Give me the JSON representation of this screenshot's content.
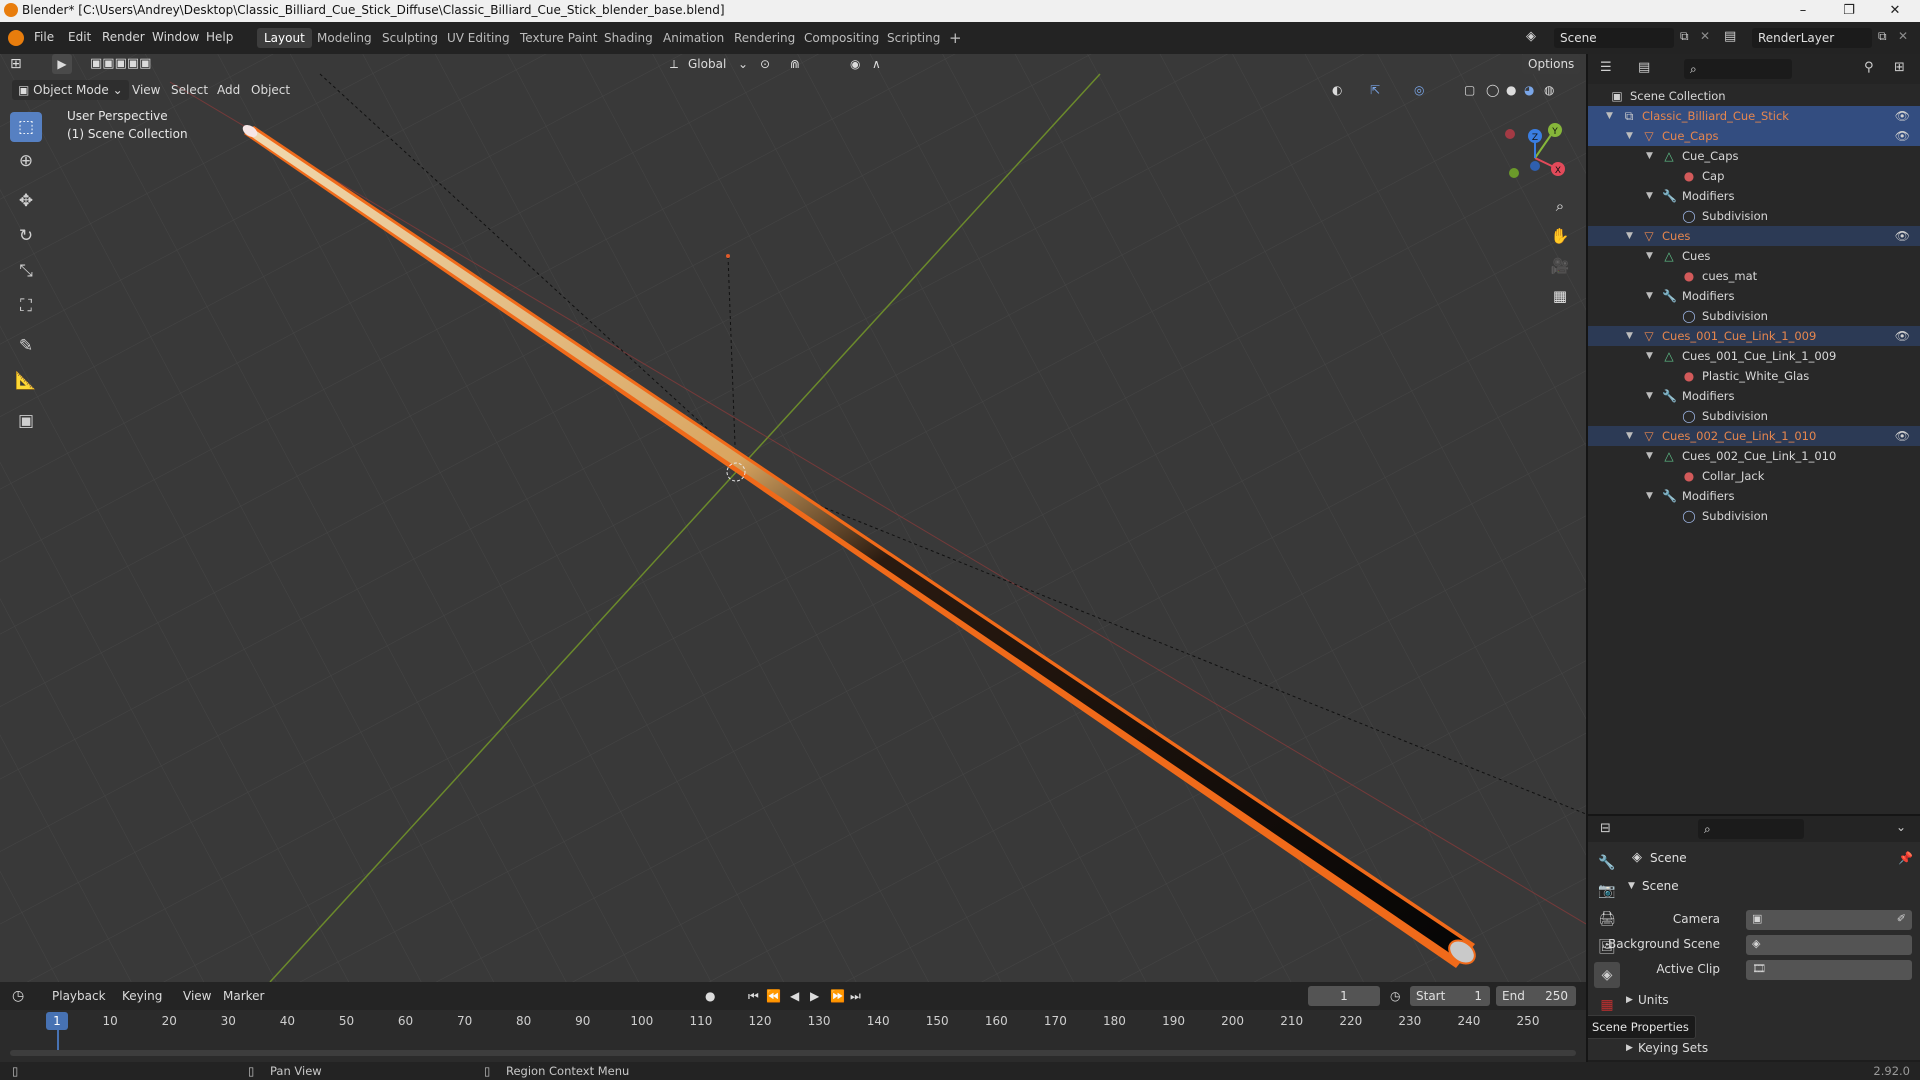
{
  "window": {
    "title": "Blender* [C:\\Users\\Andrey\\Desktop\\Classic_Billiard_Cue_Stick_Diffuse\\Classic_Billiard_Cue_Stick_blender_base.blend]",
    "minimize": "–",
    "maximize": "❐",
    "close": "✕"
  },
  "menu": [
    "File",
    "Edit",
    "Render",
    "Window",
    "Help"
  ],
  "workspaces": [
    "Layout",
    "Modeling",
    "Sculpting",
    "UV Editing",
    "Texture Paint",
    "Shading",
    "Animation",
    "Rendering",
    "Compositing",
    "Scripting"
  ],
  "add_workspace": "+",
  "scene_name": "Scene",
  "render_layer": "RenderLayer",
  "toolbar": {
    "transform_orientation": "Global",
    "options": "Options"
  },
  "viewport": {
    "mode": "Object Mode",
    "menus": [
      "View",
      "Select",
      "Add",
      "Object"
    ],
    "perspective": "User Perspective",
    "collection": "(1) Scene Collection",
    "gizmo": {
      "x": "X",
      "y": "Y",
      "z": "Z"
    }
  },
  "outliner": {
    "root": "Scene Collection",
    "rows": [
      {
        "label": "Classic_Billiard_Cue_Stick",
        "kind": "collection",
        "depth": 1,
        "open": true,
        "eye": true,
        "state": "sel",
        "color": "#e6864e"
      },
      {
        "label": "Cue_Caps",
        "kind": "object",
        "depth": 2,
        "open": true,
        "eye": true,
        "state": "sel",
        "color": "#e6864e"
      },
      {
        "label": "Cue_Caps",
        "kind": "mesh",
        "depth": 3,
        "open": true,
        "eye": false,
        "state": "",
        "color": "#d8d8d8"
      },
      {
        "label": "Cap",
        "kind": "material",
        "depth": 4,
        "open": null,
        "eye": false,
        "state": "",
        "color": "#d8d8d8"
      },
      {
        "label": "Modifiers",
        "kind": "modifier",
        "depth": 3,
        "open": true,
        "eye": false,
        "state": "",
        "color": "#d8d8d8"
      },
      {
        "label": "Subdivision",
        "kind": "subsurf",
        "depth": 4,
        "open": null,
        "eye": false,
        "state": "",
        "color": "#d8d8d8"
      },
      {
        "label": "Cues",
        "kind": "object",
        "depth": 2,
        "open": true,
        "eye": true,
        "state": "sel2",
        "color": "#e6864e"
      },
      {
        "label": "Cues",
        "kind": "mesh",
        "depth": 3,
        "open": true,
        "eye": false,
        "state": "",
        "color": "#d8d8d8"
      },
      {
        "label": "cues_mat",
        "kind": "material",
        "depth": 4,
        "open": null,
        "eye": false,
        "state": "",
        "color": "#d8d8d8"
      },
      {
        "label": "Modifiers",
        "kind": "modifier",
        "depth": 3,
        "open": true,
        "eye": false,
        "state": "",
        "color": "#d8d8d8"
      },
      {
        "label": "Subdivision",
        "kind": "subsurf",
        "depth": 4,
        "open": null,
        "eye": false,
        "state": "",
        "color": "#d8d8d8"
      },
      {
        "label": "Cues_001_Cue_Link_1_009",
        "kind": "object",
        "depth": 2,
        "open": true,
        "eye": true,
        "state": "sel2",
        "color": "#e6864e"
      },
      {
        "label": "Cues_001_Cue_Link_1_009",
        "kind": "mesh",
        "depth": 3,
        "open": true,
        "eye": false,
        "state": "",
        "color": "#d8d8d8"
      },
      {
        "label": "Plastic_White_Glas",
        "kind": "material",
        "depth": 4,
        "open": null,
        "eye": false,
        "state": "",
        "color": "#d8d8d8"
      },
      {
        "label": "Modifiers",
        "kind": "modifier",
        "depth": 3,
        "open": true,
        "eye": false,
        "state": "",
        "color": "#d8d8d8"
      },
      {
        "label": "Subdivision",
        "kind": "subsurf",
        "depth": 4,
        "open": null,
        "eye": false,
        "state": "",
        "color": "#d8d8d8"
      },
      {
        "label": "Cues_002_Cue_Link_1_010",
        "kind": "object",
        "depth": 2,
        "open": true,
        "eye": true,
        "state": "sel2",
        "color": "#e6864e"
      },
      {
        "label": "Cues_002_Cue_Link_1_010",
        "kind": "mesh",
        "depth": 3,
        "open": true,
        "eye": false,
        "state": "",
        "color": "#d8d8d8"
      },
      {
        "label": "Collar_Jack",
        "kind": "material",
        "depth": 4,
        "open": null,
        "eye": false,
        "state": "",
        "color": "#d8d8d8"
      },
      {
        "label": "Modifiers",
        "kind": "modifier",
        "depth": 3,
        "open": true,
        "eye": false,
        "state": "",
        "color": "#d8d8d8"
      },
      {
        "label": "Subdivision",
        "kind": "subsurf",
        "depth": 4,
        "open": null,
        "eye": false,
        "state": "",
        "color": "#d8d8d8"
      }
    ]
  },
  "properties": {
    "context": "Scene",
    "panel": "Scene",
    "fields": [
      {
        "label": "Camera"
      },
      {
        "label": "Background Scene"
      },
      {
        "label": "Active Clip"
      }
    ],
    "subpanels": [
      "Units",
      "Keying Sets"
    ],
    "hidden_fragment": "y",
    "tooltip": "Scene Properties"
  },
  "timeline": {
    "menus": [
      "Playback",
      "Keying",
      "View",
      "Marker"
    ],
    "current_frame": "1",
    "start_label": "Start",
    "start": "1",
    "end_label": "End",
    "end": "250",
    "ticks": [
      "10",
      "20",
      "30",
      "40",
      "50",
      "60",
      "70",
      "80",
      "90",
      "100",
      "110",
      "120",
      "130",
      "140",
      "150",
      "160",
      "170",
      "180",
      "190",
      "200",
      "210",
      "220",
      "230",
      "240",
      "250"
    ],
    "playhead": "1"
  },
  "statusbar": {
    "pan": "Pan View",
    "context_menu": "Region Context Menu",
    "version": "2.92.0"
  },
  "colors": {
    "accent": "#5680c2",
    "selection": "#334d80",
    "outline": "#f06a1a",
    "object_text": "#e6864e"
  }
}
